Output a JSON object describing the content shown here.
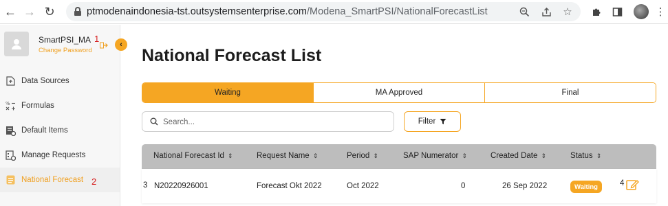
{
  "browser": {
    "url_host": "ptmodenaindonesia-tst.outsystemsenterprise.com",
    "url_path": "/Modena_SmartPSI/NationalForecastList",
    "icons": [
      "back-icon",
      "forward-icon",
      "reload-icon",
      "lock-icon",
      "zoom-icon",
      "share-icon",
      "star-icon",
      "extensions-icon",
      "sidebar-panel-icon",
      "profile-avatar",
      "more-icon"
    ]
  },
  "sidebar": {
    "user_name": "SmartPSI_MA",
    "change_password": "Change Password",
    "items": [
      {
        "label": "Data Sources",
        "icon": "document-icon"
      },
      {
        "label": "Formulas",
        "icon": "math-operators-icon"
      },
      {
        "label": "Default Items",
        "icon": "items-settings-icon"
      },
      {
        "label": "Manage Requests",
        "icon": "requests-settings-icon"
      },
      {
        "label": "National Forecast",
        "icon": "forecast-doc-icon"
      }
    ]
  },
  "annotations": {
    "a1": "1",
    "a2": "2",
    "a3": "3",
    "a4": "4"
  },
  "main": {
    "title": "National Forecast List",
    "tabs": [
      {
        "label": "Waiting",
        "active": true
      },
      {
        "label": "MA Approved",
        "active": false
      },
      {
        "label": "Final",
        "active": false
      }
    ],
    "search_placeholder": "Search...",
    "filter_label": "Filter"
  },
  "table": {
    "columns": [
      "National Forecast Id",
      "Request Name",
      "Period",
      "SAP Numerator",
      "Created Date",
      "Status"
    ],
    "sort_glyph": "⇕",
    "rows": [
      {
        "id": "N20220926001",
        "request_name": "Forecast Okt 2022",
        "period": "Oct 2022",
        "sap_numerator": "0",
        "created_date": "26 Sep 2022",
        "status": "Waiting"
      }
    ]
  },
  "colors": {
    "accent": "#f5a623",
    "header_bg": "#bdbdbd",
    "annotation": "#d62020"
  }
}
